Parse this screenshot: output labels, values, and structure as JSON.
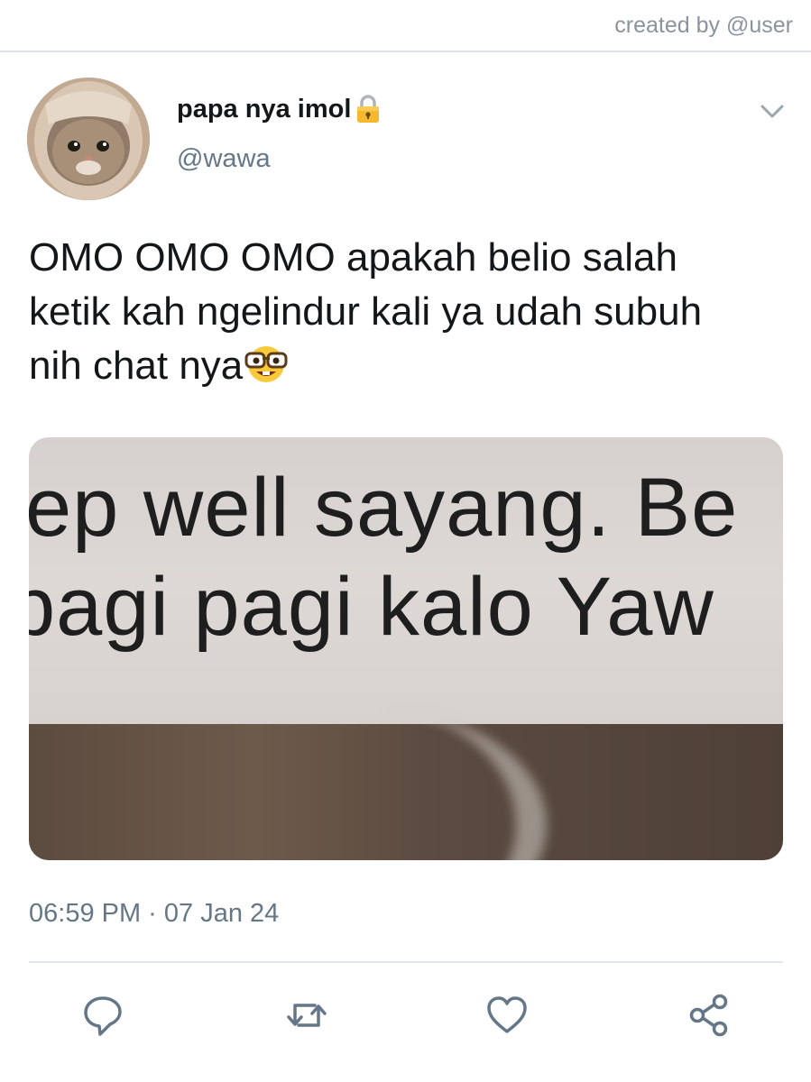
{
  "watermark": "created by @user",
  "author": {
    "display_name": "papa nya imol",
    "handle": "@wawa",
    "protected_icon": "lock-icon",
    "avatar": "cat-avatar"
  },
  "tweet": {
    "text_lines": [
      "OMO OMO OMO apakah belio salah",
      "ketik kah ngelindur kali ya udah subuh",
      "nih chat nya"
    ],
    "emoji": "nerd-face-icon"
  },
  "media": {
    "lines": [
      "ep well sayang. Be",
      "pagi pagi kalo Yaw"
    ]
  },
  "timestamp": "06:59 PM · 07 Jan 24",
  "actions": {
    "reply": "reply-icon",
    "retweet": "retweet-icon",
    "like": "like-icon",
    "share": "share-icon"
  },
  "colors": {
    "text": "#14171a",
    "secondary": "#657786",
    "icon": "#657786",
    "divider": "#e1e8ed"
  }
}
